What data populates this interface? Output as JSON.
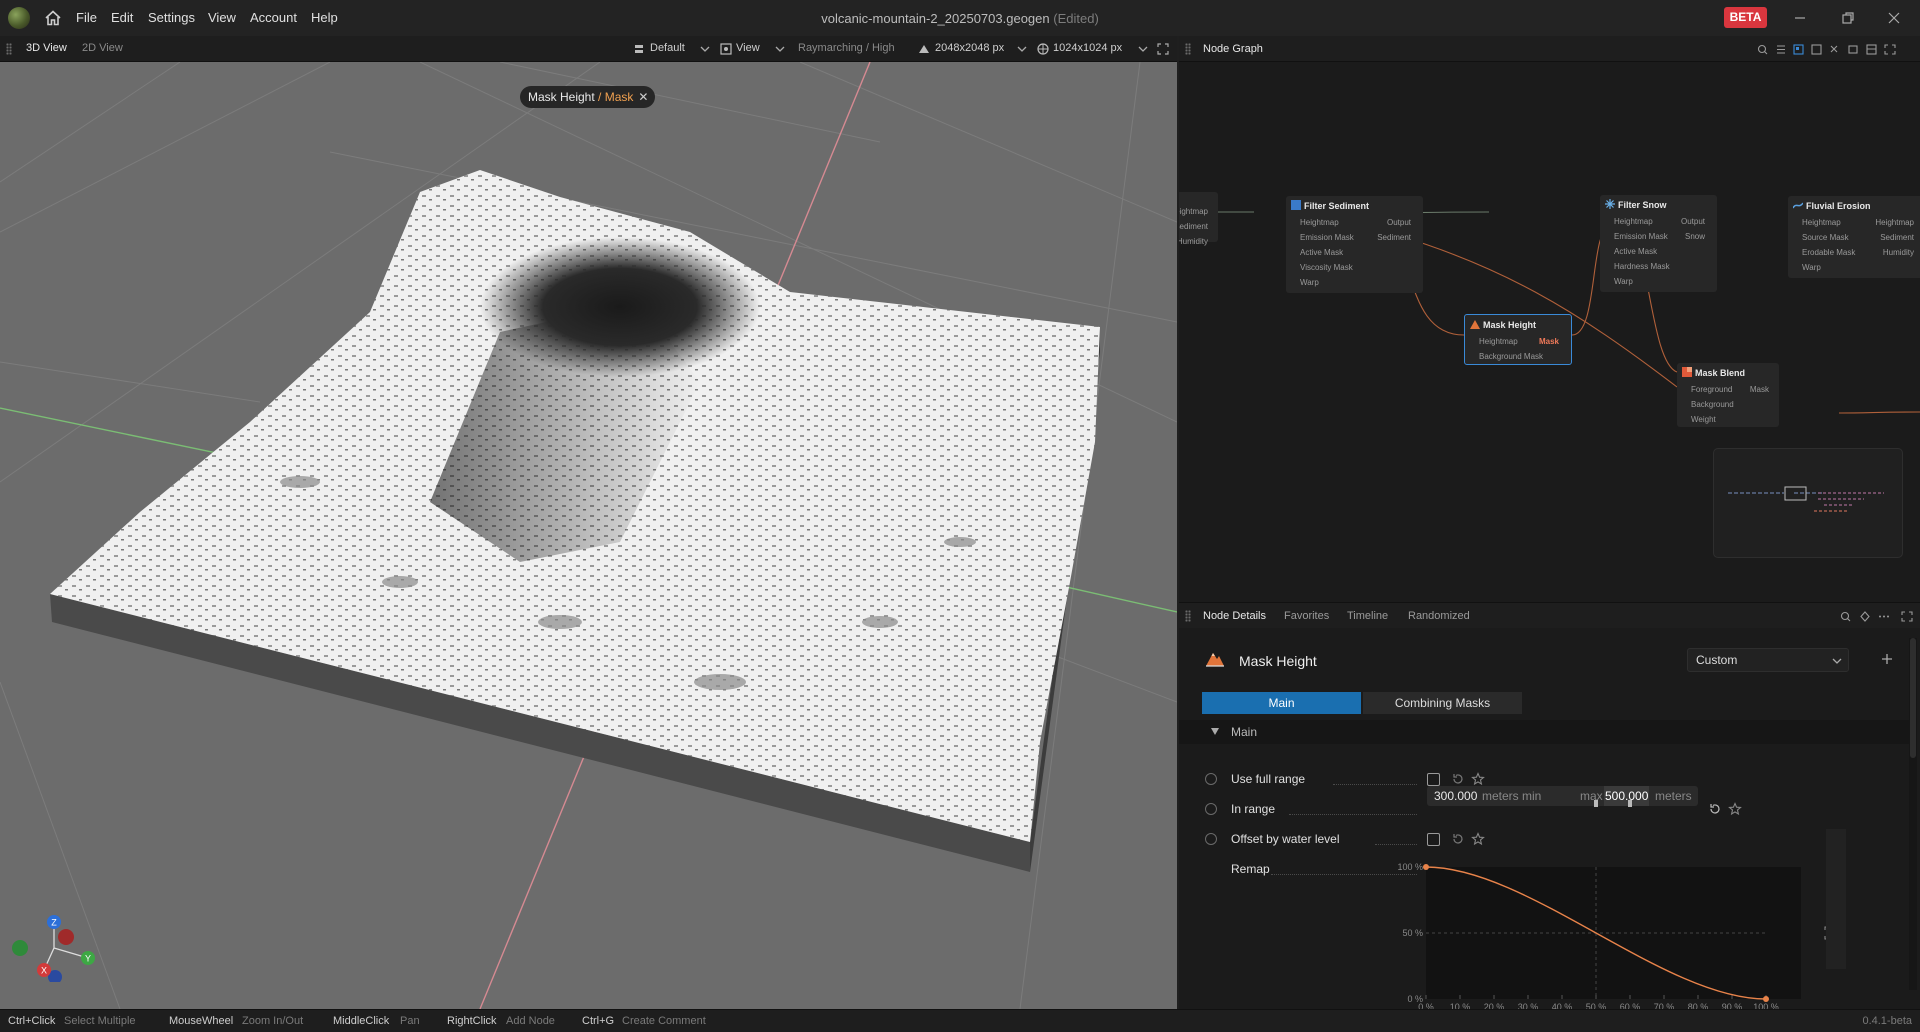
{
  "menu": [
    "File",
    "Edit",
    "Settings",
    "View",
    "Account",
    "Help"
  ],
  "title": {
    "file": "volcanic-mountain-2_20250703.geogen",
    "status": "(Edited)"
  },
  "badge": "BETA",
  "viewport": {
    "tabs": [
      "3D View",
      "2D View"
    ],
    "toolbar": {
      "preset": "Default",
      "view": "View",
      "render": "Raymarching / High",
      "resolution": "2048x2048 px",
      "preview": "1024x1024 px"
    },
    "tag": {
      "node": "Mask Height",
      "sep": " / ",
      "port": "Mask",
      "close": "✕"
    },
    "axes": {
      "z": "Z",
      "y": "Y",
      "x": "X"
    }
  },
  "node_graph": {
    "title": "Node Graph",
    "nodes": [
      {
        "name": "",
        "ports_in": [],
        "ports_out": [
          "Heightmap",
          "Sediment",
          "Humidity"
        ]
      },
      {
        "name": "Filter Sediment",
        "ports_in": [
          "Heightmap",
          "Emission Mask",
          "Active Mask",
          "Viscosity Mask",
          "Warp"
        ],
        "ports_out": [
          "Output",
          "Sediment"
        ]
      },
      {
        "name": "Filter Snow",
        "ports_in": [
          "Heightmap",
          "Emission Mask",
          "Active Mask",
          "Hardness Mask",
          "Warp"
        ],
        "ports_out": [
          "Output",
          "Snow"
        ]
      },
      {
        "name": "Fluvial Erosion",
        "ports_in": [
          "Heightmap",
          "Source Mask",
          "Erodable Mask",
          "Warp"
        ],
        "ports_out": [
          "Heightmap",
          "Sediment",
          "Humidity"
        ]
      },
      {
        "name": "Mask Height",
        "ports_in": [
          "Heightmap",
          "Background Mask"
        ],
        "ports_out": [
          "Mask"
        ]
      },
      {
        "name": "Mask Blend",
        "ports_in": [
          "Foreground",
          "Background",
          "Weight"
        ],
        "ports_out": [
          "Mask"
        ]
      }
    ]
  },
  "node_details": {
    "tabs": [
      "Node Details",
      "Favorites",
      "Timeline",
      "Randomized"
    ],
    "title": "Mask Height",
    "preset": "Custom",
    "subtabs": [
      "Main",
      "Combining Masks"
    ],
    "section": "Main",
    "params": {
      "full_range": "Use full range",
      "in_range": "In range",
      "offset": "Offset by water level",
      "remap": "Remap"
    },
    "range": {
      "min": "300.000",
      "min_unit": "meters min",
      "max_label": "max",
      "max": "500.000",
      "max_unit": "meters"
    },
    "curve": {
      "y_ticks": [
        "100 %",
        "50 %",
        "0 %"
      ],
      "x_ticks": [
        "0 %",
        "10 %",
        "20 %",
        "30 %",
        "40 %",
        "50 %",
        "60 %",
        "70 %",
        "80 %",
        "90 %",
        "100 %"
      ],
      "start": [
        0,
        100
      ],
      "end": [
        100,
        0
      ]
    }
  },
  "status_bar": [
    {
      "key": "Ctrl+Click",
      "desc": "Select Multiple"
    },
    {
      "key": "MouseWheel",
      "desc": "Zoom In/Out"
    },
    {
      "key": "MiddleClick",
      "desc": "Pan"
    },
    {
      "key": "RightClick",
      "desc": "Add Node"
    },
    {
      "key": "Ctrl+G",
      "desc": "Create Comment"
    }
  ],
  "version": "0.4.1-beta",
  "colors": {
    "accent": "#1a6fb0",
    "beta": "#d9363e",
    "curve": "#e8834a",
    "mask_port": "#f07a5a"
  }
}
